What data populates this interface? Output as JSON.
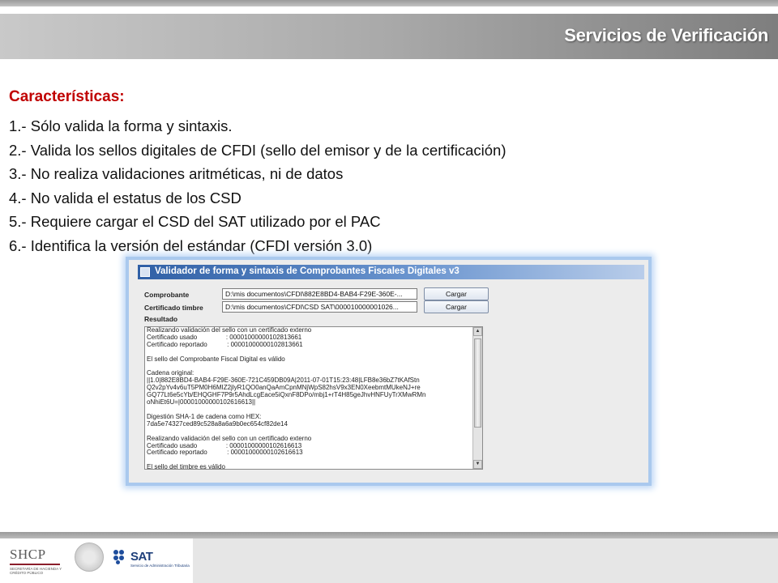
{
  "header": {
    "title": "Servicios de Verificación"
  },
  "content": {
    "heading": "Características:",
    "items": [
      "1.- Sólo valida la forma y sintaxis.",
      "2.- Valida los sellos digitales de CFDI (sello del emisor y de la certificación)",
      "3.- No realiza validaciones aritméticas, ni de datos",
      "4.- No valida el estatus de los CSD",
      "5.- Requiere cargar el CSD del SAT utilizado por el PAC",
      "6.- Identifica la versión del estándar (CFDI versión 3.0)"
    ]
  },
  "app": {
    "title": "Validador de forma y sintaxis de Comprobantes Fiscales Digitales v3",
    "comprobante_label": "Comprobante",
    "comprobante_value": "D:\\mis documentos\\CFDI\\882E8BD4-BAB4-F29E-360E-...",
    "certificado_label": "Certificado timbre",
    "certificado_value": "D:\\mis documentos\\CFDI\\CSD SAT\\000010000001026...",
    "cargar_label": "Cargar",
    "resultado_label": "Resultado",
    "resultado_text": "Realizando validación del sello con un certificado externo\nCertificado usado                : 00001000000102813661\nCertificado reportado           : 00001000000102813661\n\nEl sello del Comprobante Fiscal Digital es válido\n\nCadena original:\n||1.0|882E8BD4-BAB4-F29E-360E-721C459DB09A|2011-07-01T15:23:48|LFB8e36bZ7tKAfStn\nQ2v2pYv4v6uT5PM0H6MIZ2jlyR1QO0anQaAmCpnMNjWpS82hsV9x3EN0XeebmtMUkeNJ+re\nGQ77Lt6e5cYb/EHQGHF7P9r5AhdLcgEace5iQxnF8DPo/mbj1+rT4H85geJhvHNFUyTrXMwRMn\noNhiEt6U=|00001000000102616613||\n\nDigestión SHA-1 de cadena como HEX:\n7da5e74327ced89c528a8a6a9b0ec654cf82de14\n\nRealizando validación del sello con un certificado externo\nCertificado usado                : 00001000000102616613\nCertificado reportado           : 00001000000102616613\n\nEl sello del timbre es válido"
  },
  "footer": {
    "shcp_text": "SHCP",
    "shcp_sub": "SECRETARÍA DE HACIENDA Y CRÉDITO PÚBLICO",
    "sat_text": "SAT",
    "sat_sub": "Servicio de Administración Tributaria"
  },
  "colors": {
    "heading": "#c00000",
    "app_titlebar": "#3060a6",
    "sat_blue": "#1e4d9c",
    "shcp_red": "#8b1e2b"
  },
  "icons": [
    "app-window-icon",
    "scroll-up-arrow-icon",
    "scroll-down-arrow-icon",
    "mexico-seal-icon",
    "sat-dots-icon"
  ]
}
